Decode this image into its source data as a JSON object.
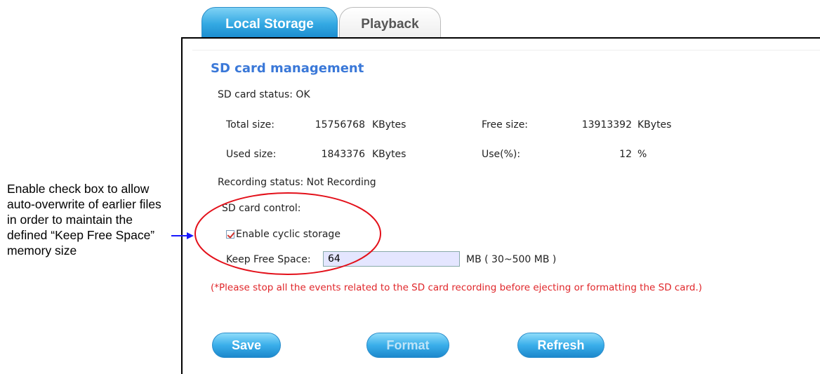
{
  "tabs": [
    {
      "label": "Local Storage",
      "active": true
    },
    {
      "label": "Playback",
      "active": false
    }
  ],
  "section": {
    "title": "SD card management"
  },
  "status": {
    "sd_status": "SD card status:  OK",
    "total_label": "Total size:",
    "total_value": "15756768",
    "total_unit": "KBytes",
    "free_label": "Free size:",
    "free_value": "13913392",
    "free_unit": "KBytes",
    "used_label": "Used size:",
    "used_value": "1843376",
    "used_unit": "KBytes",
    "use_pct_label": "Use(%):",
    "use_pct_value": "12",
    "use_pct_unit": "%",
    "recording": "Recording status:  Not Recording"
  },
  "control": {
    "heading": "SD card control:",
    "cyclic_label": "Enable cyclic storage",
    "cyclic_checked": true,
    "keep_free_label": "Keep Free Space:",
    "keep_free_value": "64",
    "keep_free_hint": "MB ( 30~500 MB )",
    "warning": "(*Please stop all the events related to the SD card recording before ejecting or formatting the SD card.)"
  },
  "buttons": {
    "save": "Save",
    "format": "Format",
    "refresh": "Refresh"
  },
  "annotation": {
    "text": "Enable check box to allow auto-overwrite of earlier files in order to maintain the defined “Keep Free Space” memory size",
    "arrow_color": "#1a1aff",
    "circle_color": "#e3101a"
  },
  "colors": {
    "accent": "#3a78d8",
    "warning": "#e0262a",
    "tab_active": "#34a9e3"
  }
}
